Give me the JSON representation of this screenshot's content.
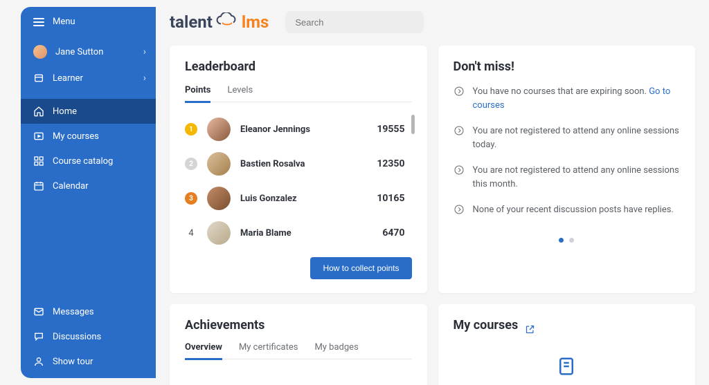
{
  "sidebar": {
    "menu_label": "Menu",
    "user_name": "Jane Sutton",
    "role_label": "Learner",
    "nav": [
      {
        "label": "Home"
      },
      {
        "label": "My courses"
      },
      {
        "label": "Course catalog"
      },
      {
        "label": "Calendar"
      }
    ],
    "footer_nav": [
      {
        "label": "Messages"
      },
      {
        "label": "Discussions"
      },
      {
        "label": "Show tour"
      }
    ]
  },
  "logo": {
    "left": "talent",
    "right": "lms"
  },
  "search": {
    "placeholder": "Search"
  },
  "leaderboard": {
    "title": "Leaderboard",
    "tabs": {
      "points": "Points",
      "levels": "Levels"
    },
    "rows": [
      {
        "rank": "1",
        "name": "Eleanor Jennings",
        "score": "19555"
      },
      {
        "rank": "2",
        "name": "Bastien Rosalva",
        "score": "12350"
      },
      {
        "rank": "3",
        "name": "Luis Gonzalez",
        "score": "10165"
      },
      {
        "rank": "4",
        "name": "Maria Blame",
        "score": "6470"
      }
    ],
    "button": "How to collect points"
  },
  "dont_miss": {
    "title": "Don't miss!",
    "items": [
      {
        "text": "You have no courses that are expiring soon. ",
        "link": "Go to courses"
      },
      {
        "text": "You are not registered to attend any online sessions today."
      },
      {
        "text": "You are not registered to attend any online sessions this month."
      },
      {
        "text": "None of your recent discussion posts have replies."
      }
    ]
  },
  "achievements": {
    "title": "Achievements",
    "tabs": {
      "overview": "Overview",
      "certs": "My certificates",
      "badges": "My badges"
    }
  },
  "my_courses": {
    "title": "My courses"
  }
}
